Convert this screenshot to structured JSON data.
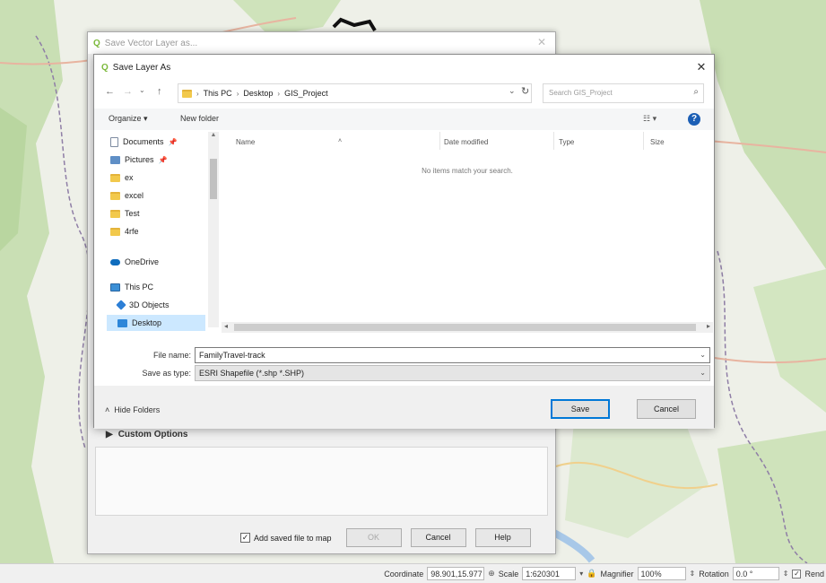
{
  "background_dialog": {
    "title": "Save Vector Layer as...",
    "custom_options_label": "Custom Options",
    "add_saved_file_label": "Add saved file to map",
    "add_saved_file_checked": true,
    "ok_label": "OK",
    "cancel_label": "Cancel",
    "help_label": "Help"
  },
  "save_dialog": {
    "title": "Save Layer As",
    "close_glyph": "✕",
    "nav": {
      "back": "←",
      "forward": "→",
      "dropdown": "⌄",
      "up": "↑"
    },
    "address": {
      "parts": [
        "This PC",
        "Desktop",
        "GIS_Project"
      ],
      "separator": "›"
    },
    "search_placeholder": "Search GIS_Project",
    "toolbar": {
      "organize_label": "Organize ▾",
      "new_folder_label": "New folder",
      "view_label": "☷ ▾",
      "help_glyph": "?"
    },
    "nav_items": [
      {
        "label": "Documents",
        "icon": "document-icon",
        "pinned": true
      },
      {
        "label": "Pictures",
        "icon": "pictures-icon",
        "pinned": true
      },
      {
        "label": "ex",
        "icon": "folder-icon",
        "pinned": false
      },
      {
        "label": "excel",
        "icon": "folder-icon",
        "pinned": false
      },
      {
        "label": "Test",
        "icon": "folder-icon",
        "pinned": false
      },
      {
        "label": "4rfe",
        "icon": "folder-icon",
        "pinned": false
      },
      {
        "label": "OneDrive",
        "icon": "cloud-icon",
        "pinned": false
      },
      {
        "label": "This PC",
        "icon": "computer-icon",
        "pinned": false
      },
      {
        "label": "3D Objects",
        "icon": "3d-objects-icon",
        "pinned": false
      },
      {
        "label": "Desktop",
        "icon": "desktop-icon",
        "pinned": false,
        "selected": true
      }
    ],
    "columns": [
      "Name",
      "Date modified",
      "Type",
      "Size"
    ],
    "empty_message": "No items match your search.",
    "file_name_label": "File name:",
    "file_name_value": "FamilyTravel-track",
    "save_type_label": "Save as type:",
    "save_type_value": "ESRI Shapefile (*.shp *.SHP)",
    "hide_folders_label": "Hide Folders",
    "save_label": "Save",
    "cancel_label": "Cancel"
  },
  "status_bar": {
    "coordinate_label": "Coordinate",
    "coordinate_value": "98.901,15.977",
    "scale_label": "Scale",
    "scale_value": "1:620301",
    "magnifier_label": "Magnifier",
    "magnifier_value": "100%",
    "rotation_label": "Rotation",
    "rotation_value": "0.0 °",
    "render_label": "Rend"
  },
  "colors": {
    "map_land": "#eef0e8",
    "map_forest": "#c9dfb4",
    "map_road": "#e8b4a0",
    "map_border": "#8f7ea6",
    "accent": "#0078d7",
    "selection": "#cce8ff"
  }
}
